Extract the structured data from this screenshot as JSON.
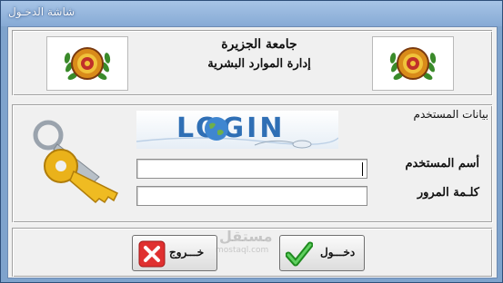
{
  "window": {
    "title": "شاشة الدخـول"
  },
  "header": {
    "title": "جامعة الجزيرة",
    "subtitle": "إدارة الموارد البشرية",
    "logo_text": "UNIVERSITY OF GEZIRA"
  },
  "main": {
    "group_label": "بيانات المستخدم",
    "banner_text": "LOGIN",
    "username_label": "أسم المستخدم",
    "password_label": "كلـمة المرور",
    "username_value": "",
    "password_value": ""
  },
  "buttons": {
    "exit_label": "خـــروج",
    "login_label": "دخـــول"
  },
  "watermark": {
    "text": "مستقل",
    "sub": "mostaql.com"
  },
  "colors": {
    "titlebar": "#86aad5",
    "client_bg": "#f0f0f0",
    "banner_blue": "#2f6fb5",
    "exit_red": "#e03030",
    "check_green": "#2aa52a",
    "key_gold": "#e8b21a"
  }
}
